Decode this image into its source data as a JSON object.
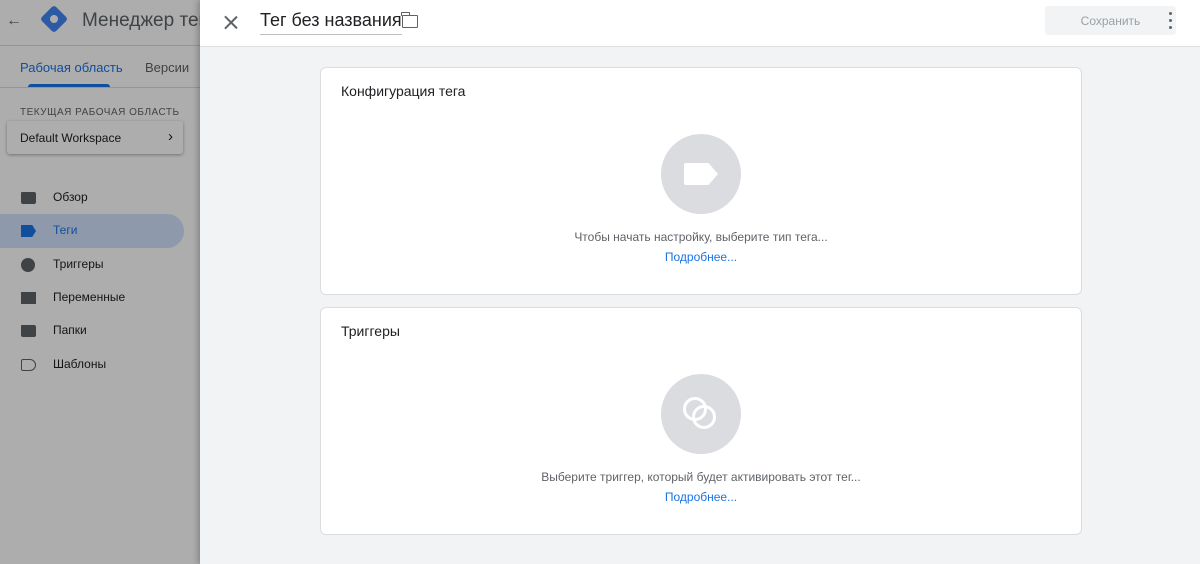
{
  "app": {
    "title": "Менеджер тегов",
    "tabs": [
      {
        "label": "Рабочая область",
        "active": true
      },
      {
        "label": "Версии",
        "active": false
      }
    ]
  },
  "sidebar": {
    "workspace_label": "ТЕКУЩАЯ РАБОЧАЯ ОБЛАСТЬ",
    "workspace_name": "Default Workspace",
    "items": [
      {
        "label": "Обзор",
        "icon": "folder-icon",
        "active": false
      },
      {
        "label": "Теги",
        "icon": "tag-icon",
        "active": true
      },
      {
        "label": "Триггеры",
        "icon": "trigger-icon",
        "active": false
      },
      {
        "label": "Переменные",
        "icon": "variables-icon",
        "active": false
      },
      {
        "label": "Папки",
        "icon": "folder-icon",
        "active": false
      },
      {
        "label": "Шаблоны",
        "icon": "template-icon",
        "active": false
      }
    ]
  },
  "panel": {
    "tag_name": "Тег без названия",
    "save_label": "Сохранить",
    "config_card": {
      "title": "Конфигурация тега",
      "description": "Чтобы начать настройку, выберите тип тега...",
      "link": "Подробнее..."
    },
    "triggers_card": {
      "title": "Триггеры",
      "description": "Выберите триггер, который будет активировать этот тег...",
      "link": "Подробнее..."
    }
  },
  "colors": {
    "accent": "#1a73e8",
    "placeholder": "#dadce0",
    "overlay": "rgba(0,0,0,0.32)"
  }
}
